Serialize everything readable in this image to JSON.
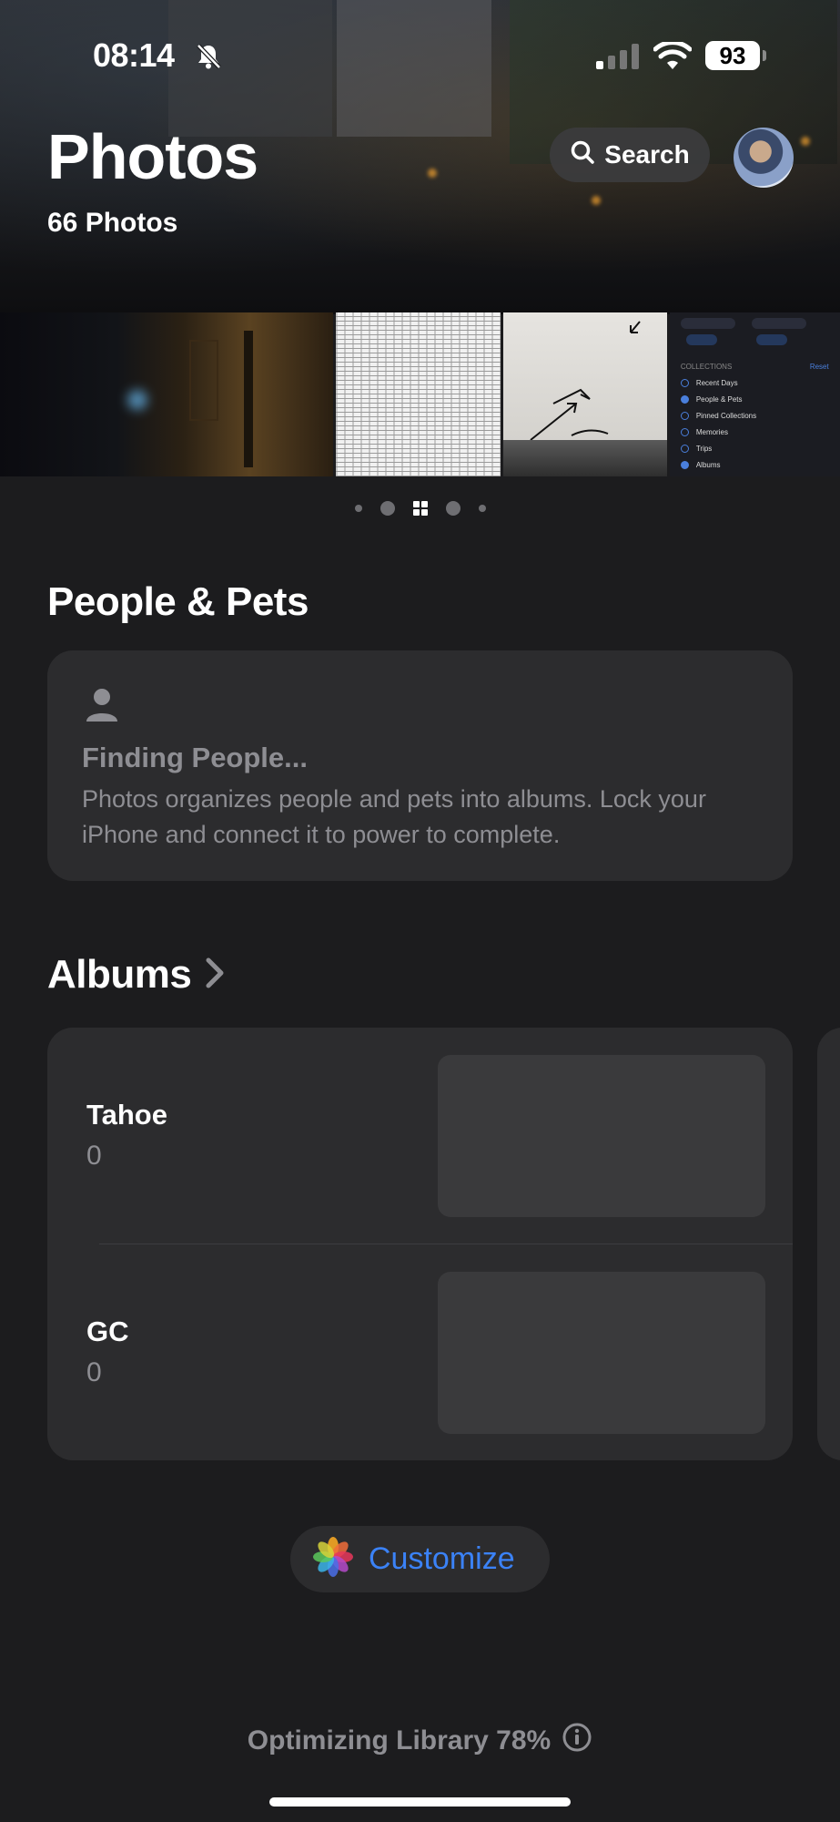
{
  "status_bar": {
    "time": "08:14",
    "battery": "93",
    "icons": [
      "bell-slash-icon",
      "cellular-signal-icon",
      "wifi-icon",
      "battery-icon"
    ]
  },
  "header": {
    "title": "Photos",
    "count": "66 Photos",
    "search_label": "Search",
    "search_icon": "search-icon",
    "avatar_icon": "profile-avatar"
  },
  "carousel": {
    "collections_preview": {
      "heading": "COLLECTIONS",
      "reset": "Reset",
      "items": [
        "Recent Days",
        "People & Pets",
        "Pinned Collections",
        "Memories",
        "Trips",
        "Albums"
      ]
    }
  },
  "people_pets": {
    "title": "People & Pets",
    "status": "Finding People...",
    "description": "Photos organizes people and pets into albums. Lock your iPhone and connect it to power to complete."
  },
  "albums": {
    "title": "Albums",
    "items": [
      {
        "name": "Tahoe",
        "count": "0"
      },
      {
        "name": "GC",
        "count": "0"
      }
    ]
  },
  "customize": {
    "label": "Customize",
    "icon": "photos-app-icon"
  },
  "footer": {
    "status": "Optimizing Library 78%",
    "progress_percent": 78,
    "info_icon": "info-icon"
  },
  "colors": {
    "background": "#1c1c1e",
    "card": "#2c2c2e",
    "accent": "#3b82f6",
    "secondary_text": "#8e8e93"
  }
}
